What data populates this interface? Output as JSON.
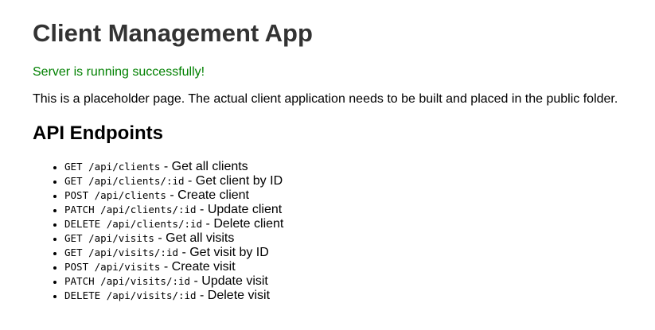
{
  "header": {
    "title": "Client Management App"
  },
  "status": {
    "message": "Server is running successfully!",
    "color": "#008000"
  },
  "intro": {
    "text": "This is a placeholder page. The actual client application needs to be built and placed in the public folder."
  },
  "endpoints": {
    "heading": "API Endpoints",
    "separator": " - ",
    "items": [
      {
        "method": "GET",
        "path": "/api/clients",
        "description": "Get all clients"
      },
      {
        "method": "GET",
        "path": "/api/clients/:id",
        "description": "Get client by ID"
      },
      {
        "method": "POST",
        "path": "/api/clients",
        "description": "Create client"
      },
      {
        "method": "PATCH",
        "path": "/api/clients/:id",
        "description": "Update client"
      },
      {
        "method": "DELETE",
        "path": "/api/clients/:id",
        "description": "Delete client"
      },
      {
        "method": "GET",
        "path": "/api/visits",
        "description": "Get all visits"
      },
      {
        "method": "GET",
        "path": "/api/visits/:id",
        "description": "Get visit by ID"
      },
      {
        "method": "POST",
        "path": "/api/visits",
        "description": "Create visit"
      },
      {
        "method": "PATCH",
        "path": "/api/visits/:id",
        "description": "Update visit"
      },
      {
        "method": "DELETE",
        "path": "/api/visits/:id",
        "description": "Delete visit"
      }
    ]
  }
}
